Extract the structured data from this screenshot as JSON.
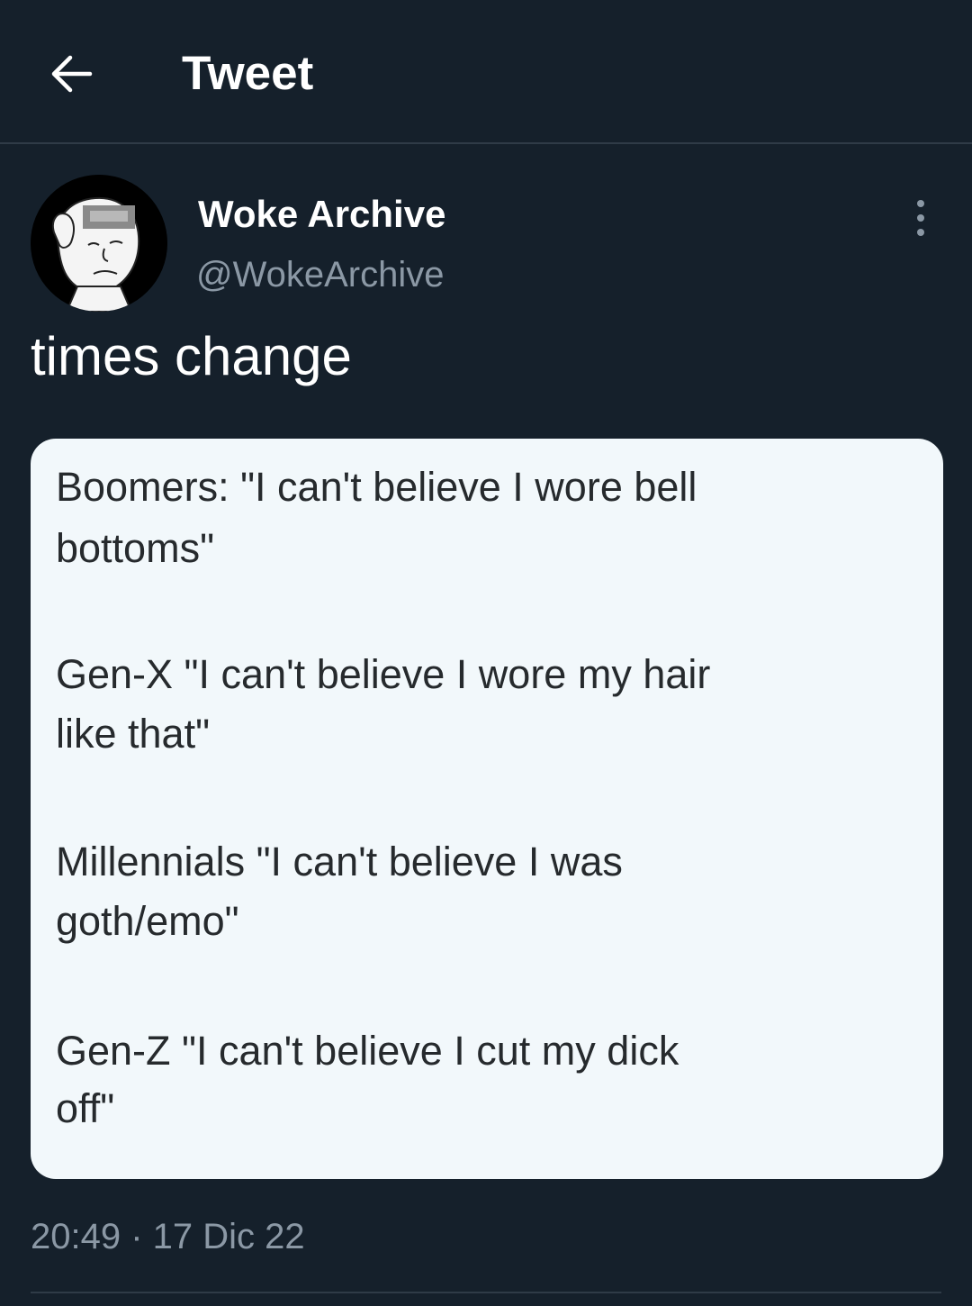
{
  "header": {
    "title": "Tweet"
  },
  "author": {
    "name": "Woke Archive",
    "handle": "@WokeArchive"
  },
  "tweet": {
    "text": "times change",
    "media_lines": [
      "Boomers: \"I can't believe I wore bell",
      "bottoms\"",
      "Gen-X \"I can't believe I wore my hair",
      "like that\"",
      "Millennials \"I can't believe I was",
      "goth/emo\"",
      "Gen-Z \"I can't believe I cut my dick",
      "off\""
    ],
    "time": "20:49",
    "separator": " · ",
    "date": "17 Dic 22"
  },
  "icons": {
    "back": "arrow-left-icon",
    "more": "more-vertical-icon"
  },
  "colors": {
    "background": "#15202b",
    "secondary_text": "#8b98a5",
    "divider": "#2f3b47",
    "media_background": "#f2f8fb"
  }
}
